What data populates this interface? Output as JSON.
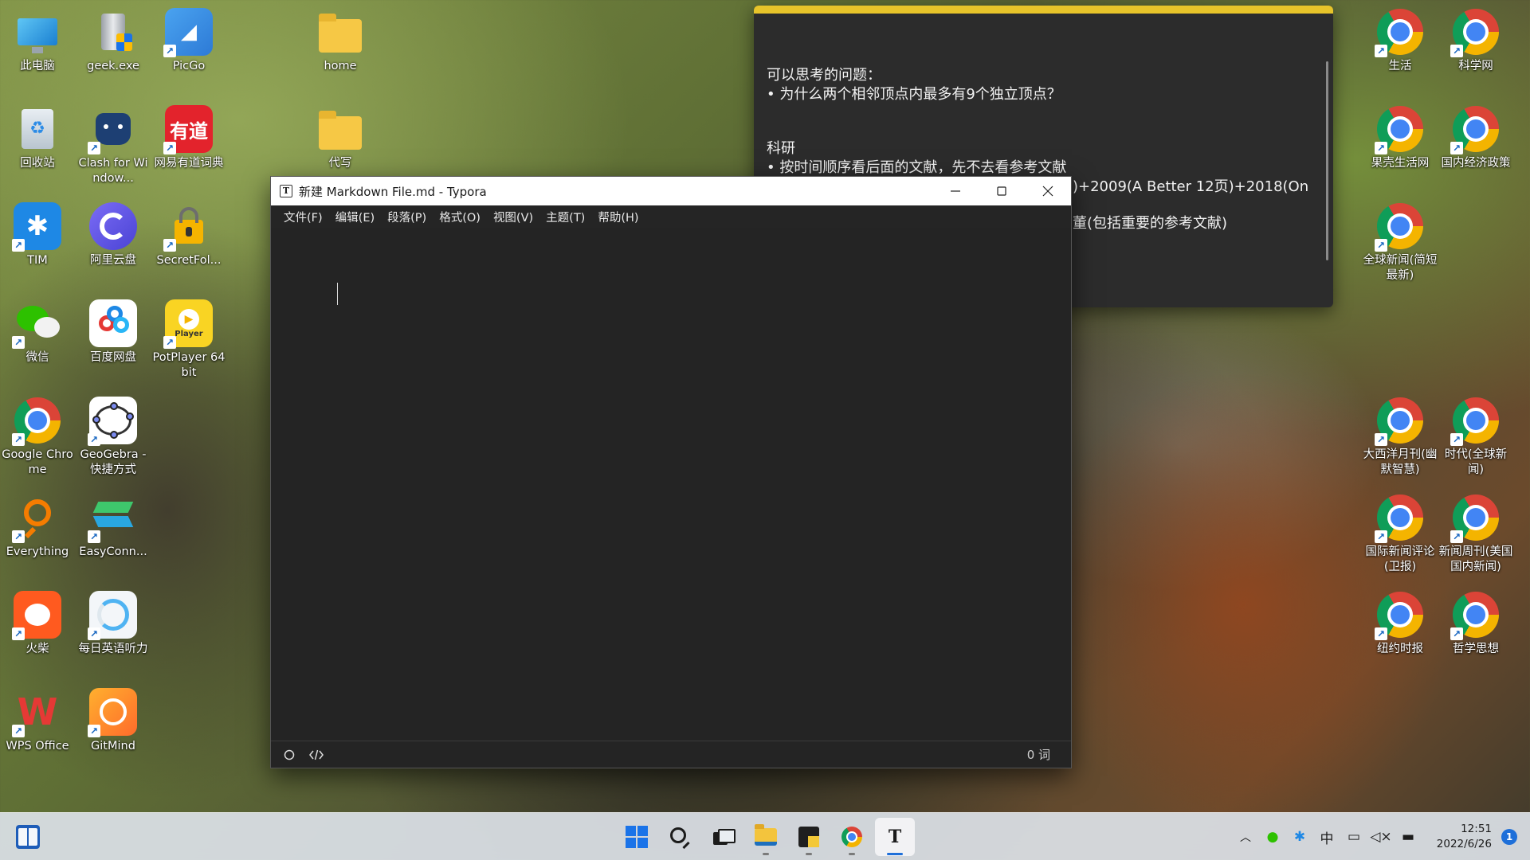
{
  "desktop": {
    "icons": [
      {
        "label": "此电脑",
        "icon": "computer-icon"
      },
      {
        "label": "geek.exe",
        "icon": "geek-icon"
      },
      {
        "label": "PicGo",
        "icon": "picgo-icon"
      },
      {
        "label": "home",
        "icon": "folder-icon"
      },
      {
        "label": "回收站",
        "icon": "recycle-bin-icon"
      },
      {
        "label": "Clash for Window...",
        "icon": "clash-icon"
      },
      {
        "label": "网易有道词典",
        "icon": "youdao-icon",
        "glyph_text": "有道"
      },
      {
        "label": "代写",
        "icon": "folder-icon"
      },
      {
        "label": "TIM",
        "icon": "tim-icon"
      },
      {
        "label": "阿里云盘",
        "icon": "aliyun-drive-icon"
      },
      {
        "label": "SecretFol...",
        "icon": "secret-folder-icon"
      },
      {
        "label": "微信",
        "icon": "wechat-icon"
      },
      {
        "label": "百度网盘",
        "icon": "baidu-netdisk-icon"
      },
      {
        "label": "PotPlayer 64 bit",
        "icon": "potplayer-icon",
        "glyph_text": "Player"
      },
      {
        "label": "Google Chrome",
        "icon": "chrome-icon"
      },
      {
        "label": "GeoGebra - 快捷方式",
        "icon": "geogebra-icon"
      },
      {
        "label": "Everything",
        "icon": "everything-icon"
      },
      {
        "label": "EasyConn...",
        "icon": "easyconnect-icon"
      },
      {
        "label": "火柴",
        "icon": "huochai-icon"
      },
      {
        "label": "每日英语听力",
        "icon": "english-listening-icon"
      },
      {
        "label": "WPS Office",
        "icon": "wps-icon"
      },
      {
        "label": "GitMind",
        "icon": "gitmind-icon"
      },
      {
        "label": "生活",
        "icon": "chrome-icon"
      },
      {
        "label": "科学网",
        "icon": "chrome-icon"
      },
      {
        "label": "果壳生活网",
        "icon": "chrome-icon"
      },
      {
        "label": "国内经济政策",
        "icon": "chrome-icon"
      },
      {
        "label": "全球新闻(简短最新)",
        "icon": "chrome-icon"
      },
      {
        "label": "大西洋月刊(幽默智慧)",
        "icon": "chrome-icon"
      },
      {
        "label": "时代(全球新闻)",
        "icon": "chrome-icon"
      },
      {
        "label": "国际新闻评论(卫报)",
        "icon": "chrome-icon"
      },
      {
        "label": "新闻周刊(美国国内新闻)",
        "icon": "chrome-icon"
      },
      {
        "label": "纽约时报",
        "icon": "chrome-icon"
      },
      {
        "label": "哲学思想",
        "icon": "chrome-icon"
      }
    ]
  },
  "sticky_note": {
    "lines": [
      "可以思考的问题：",
      "• 为什么两个相邻顶点内最多有9个独立顶点？",
      "科研",
      "• 按时间顺序看后面的文献，先不去看参考文献",
      ")+2009(A Better 12页)+2018(On",
      "董(包括重要的参考文献)"
    ]
  },
  "typora": {
    "title": "新建 Markdown File.md - Typora",
    "menu": [
      "文件(F)",
      "编辑(E)",
      "段落(P)",
      "格式(O)",
      "视图(V)",
      "主题(T)",
      "帮助(H)"
    ],
    "word_count": "0 词"
  },
  "taskbar": {
    "input_method": "中",
    "time": "12:51",
    "date": "2022/6/26",
    "notification_count": "1"
  }
}
